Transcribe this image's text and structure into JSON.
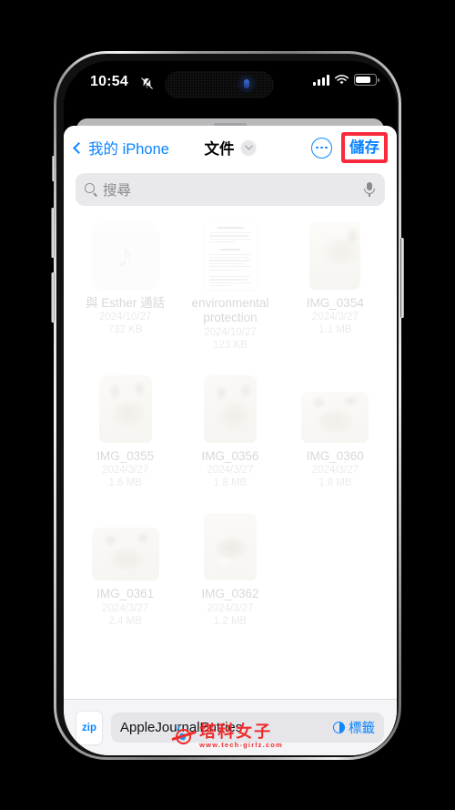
{
  "status_bar": {
    "time": "10:54",
    "mute_icon": "bell-slash-icon",
    "signal_icon": "cellular-bars-icon",
    "wifi_icon": "wifi-icon",
    "battery_icon": "battery-icon"
  },
  "navbar": {
    "back_label": "我的 iPhone",
    "back_icon": "chevron-left-icon",
    "title": "文件",
    "title_chevron_icon": "chevron-down-icon",
    "more_icon": "ellipsis-circle-icon",
    "save_label": "儲存",
    "highlight_color": "#f82a3c",
    "accent_color": "#0a84ff"
  },
  "search": {
    "placeholder": "搜尋",
    "value": "",
    "search_icon": "search-icon",
    "mic_icon": "microphone-icon"
  },
  "files": [
    {
      "name": "與 Esther 通話",
      "date": "2024/10/27",
      "size": "732 KB",
      "kind": "audio",
      "thumb": "music-note-icon"
    },
    {
      "name": "environmental protection",
      "date": "2024/10/27",
      "size": "123 KB",
      "kind": "document",
      "thumb": "document-page-preview"
    },
    {
      "name": "IMG_0354",
      "date": "2024/3/27",
      "size": "1.1 MB",
      "kind": "photo",
      "thumb": "cat-photo-portrait"
    },
    {
      "name": "IMG_0355",
      "date": "2024/3/27",
      "size": "1.6 MB",
      "kind": "photo",
      "thumb": "cat-photo-portrait"
    },
    {
      "name": "IMG_0356",
      "date": "2024/3/27",
      "size": "1.8 MB",
      "kind": "photo",
      "thumb": "cat-photo-portrait"
    },
    {
      "name": "IMG_0360",
      "date": "2024/3/27",
      "size": "1.8 MB",
      "kind": "photo",
      "thumb": "cat-photo-landscape"
    },
    {
      "name": "IMG_0361",
      "date": "2024/3/27",
      "size": "2.4 MB",
      "kind": "photo",
      "thumb": "cat-photo-landscape"
    },
    {
      "name": "IMG_0362",
      "date": "2024/3/27",
      "size": "1.2 MB",
      "kind": "photo",
      "thumb": "cat-photo-portrait"
    }
  ],
  "bottom_bar": {
    "zip_badge": "zip",
    "filename_value": "AppleJournalEntries",
    "tag_label": "標籤",
    "tag_icon": "tag-circle-icon"
  },
  "watermark": {
    "brand": "塔科女子",
    "url": "www.tech-girlz.com"
  }
}
